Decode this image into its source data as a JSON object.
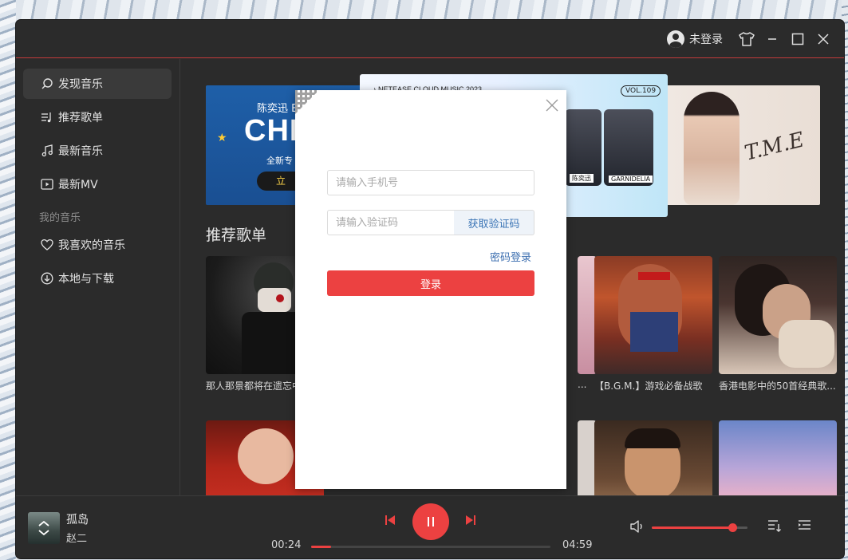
{
  "titlebar": {
    "user_label": "未登录"
  },
  "sidebar": {
    "items": [
      {
        "label": "发现音乐",
        "icon": "search-icon"
      },
      {
        "label": "推荐歌单",
        "icon": "playlist-icon"
      },
      {
        "label": "最新音乐",
        "icon": "music-note-icon"
      },
      {
        "label": "最新MV",
        "icon": "video-icon"
      }
    ],
    "section_label": "我的音乐",
    "my_items": [
      {
        "label": "我喜欢的音乐",
        "icon": "heart-icon"
      },
      {
        "label": "本地与下载",
        "icon": "download-icon"
      }
    ]
  },
  "banners": {
    "left": {
      "name": "陈奕迅 E",
      "title": "CHI",
      "subtitle": "全新专",
      "button": "立"
    },
    "middle": {
      "header": "♪ NETEASE CLOUD MUSIC 2023",
      "vol": "VOL.109",
      "card1_label": "陈奕迅",
      "card2_label": "GARNIDELIA"
    },
    "right": {
      "signature": "T.M.E"
    }
  },
  "main": {
    "section_title": "推荐歌单",
    "playlists": [
      {
        "caption": "那人那景都将在遗忘中"
      },
      {
        "caption": "..."
      },
      {
        "caption": "【B.G.M.】游戏必备战歌"
      },
      {
        "caption": "香港电影中的50首经典歌..."
      }
    ]
  },
  "login_modal": {
    "phone_placeholder": "请输入手机号",
    "code_placeholder": "请输入验证码",
    "get_code_label": "获取验证码",
    "password_login_label": "密码登录",
    "login_label": "登录"
  },
  "player": {
    "song_title": "孤岛",
    "artist": "赵二",
    "current_time": "00:24",
    "total_time": "04:59",
    "progress": 0.083,
    "volume": 0.85,
    "accent": "#ec4141"
  }
}
